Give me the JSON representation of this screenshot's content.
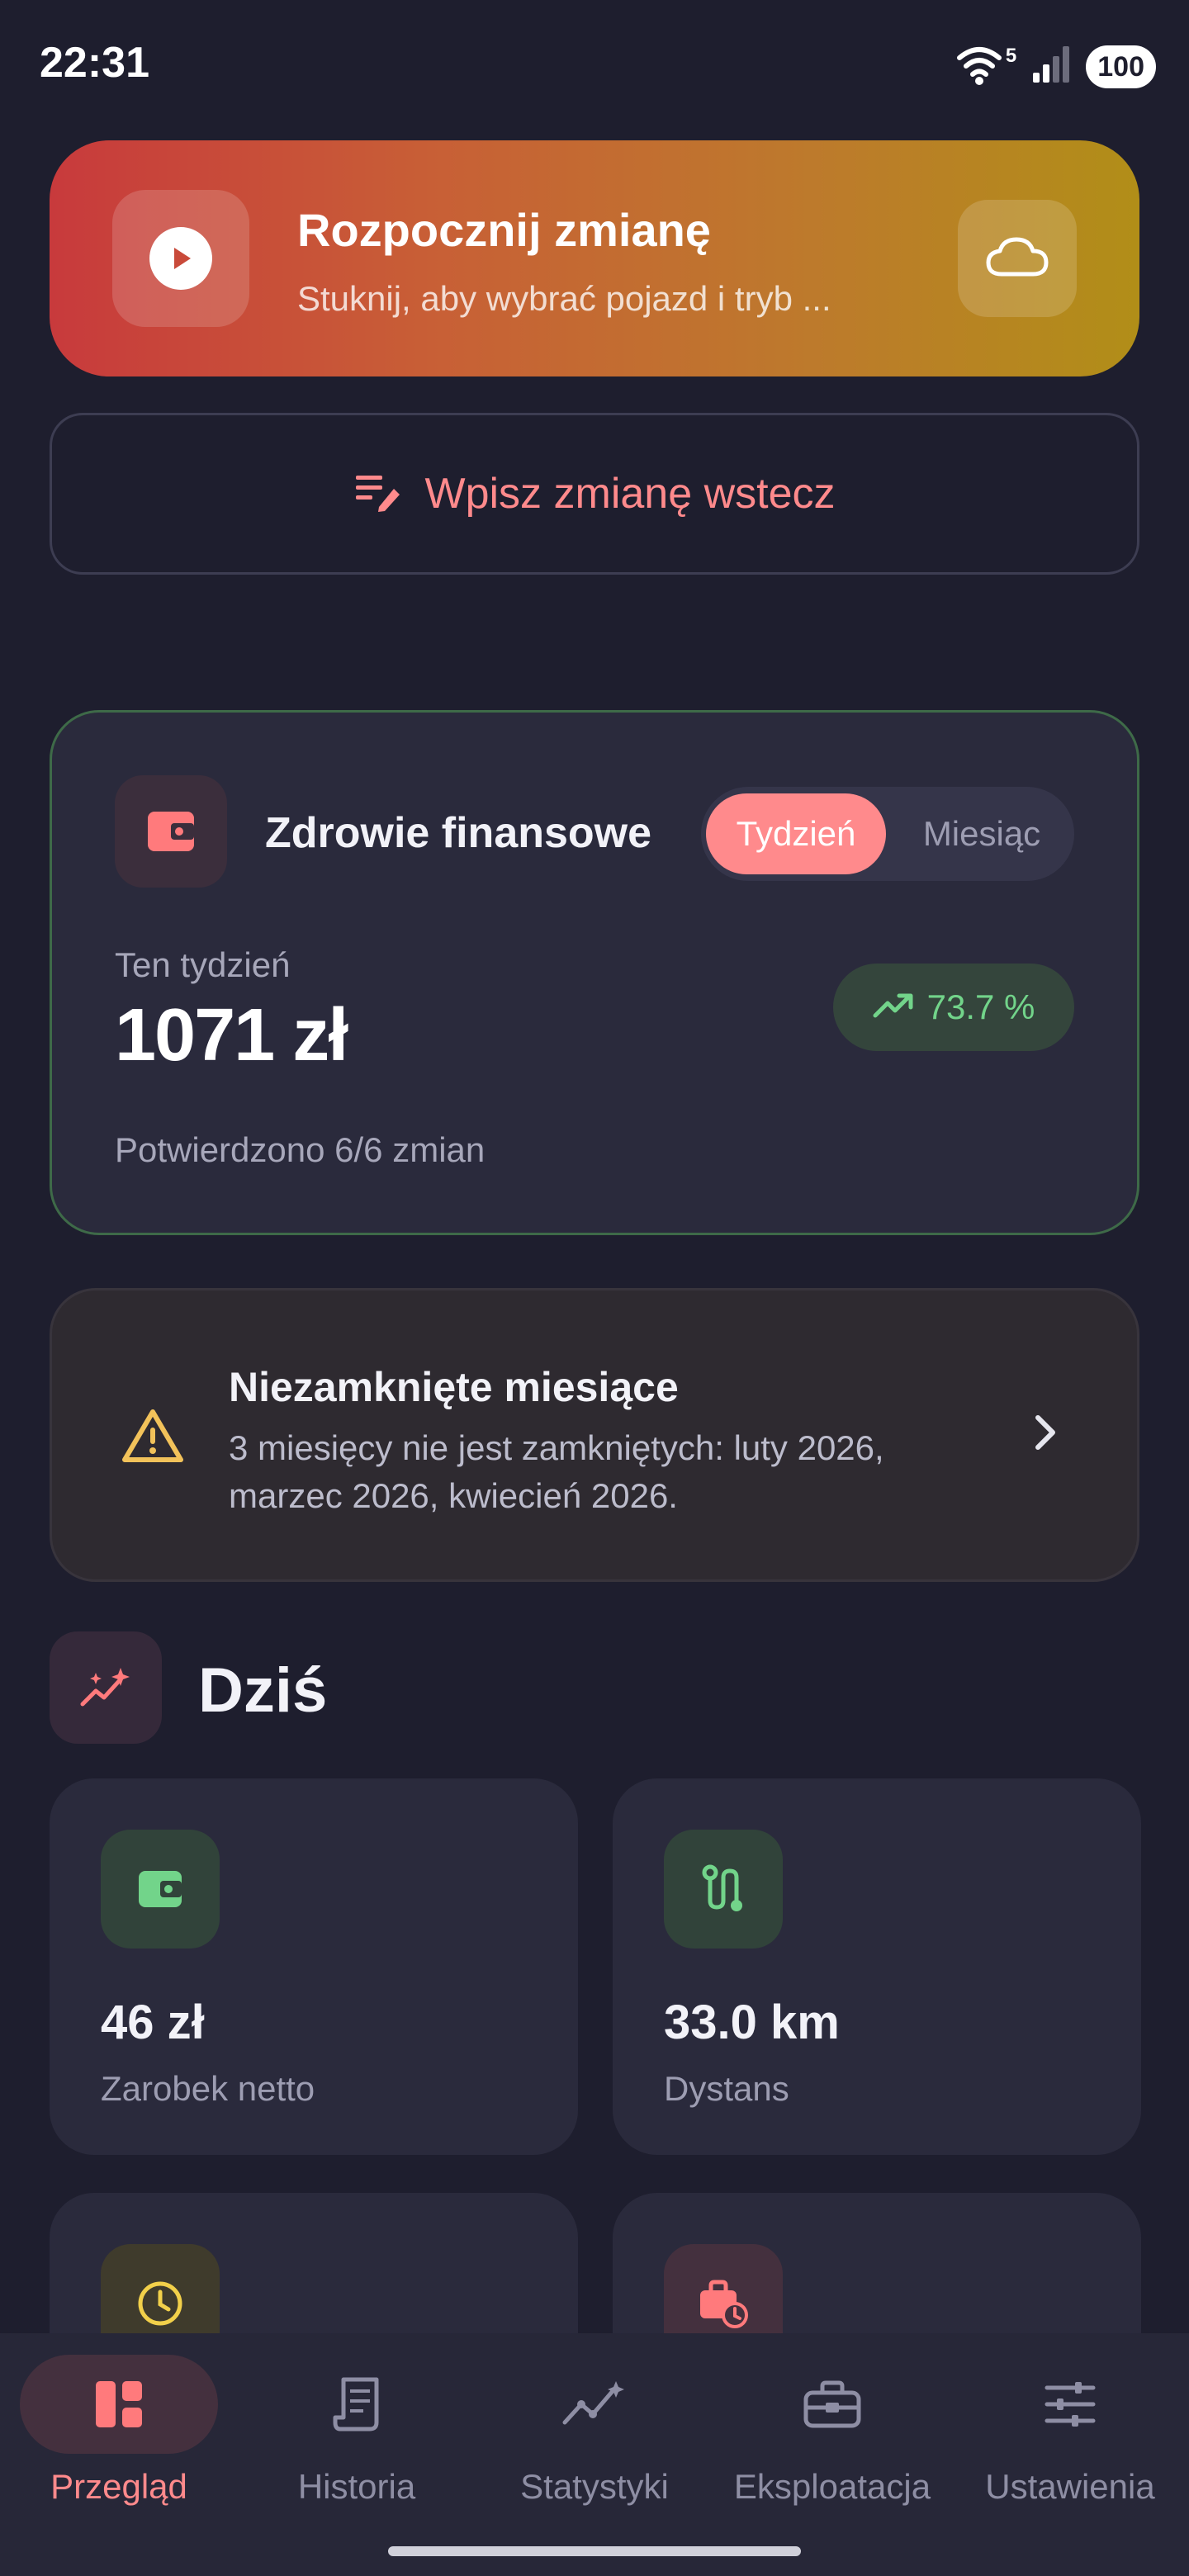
{
  "status_bar": {
    "time": "22:31",
    "wifi_badge": "5",
    "battery": "100"
  },
  "shift_banner": {
    "title": "Rozpocznij zmianę",
    "subtitle": "Stuknij, aby wybrać pojazd i tryb ...",
    "play_icon": "play-icon",
    "cloud_icon": "cloud-icon"
  },
  "retro_button": {
    "label": "Wpisz zmianę wstecz",
    "icon": "edit-note-icon"
  },
  "finance": {
    "title": "Zdrowie finansowe",
    "toggle": {
      "week": "Tydzień",
      "month": "Miesiąc",
      "selected": "Tydzień"
    },
    "period_label": "Ten tydzień",
    "amount": "1071 zł",
    "trend": "73.7 %",
    "confirmed": "Potwierdzono 6/6 zmian",
    "colors": {
      "accent": "#ff8a8c",
      "positive": "#72d48a"
    }
  },
  "warning": {
    "title": "Niezamknięte miesiące",
    "body": "3 miesięcy nie jest zamkniętych: luty 2026, marzec 2026, kwiecień 2026."
  },
  "today": {
    "title": "Dziś",
    "tiles": [
      {
        "value": "46 zł",
        "label": "Zarobek netto",
        "icon": "wallet-icon",
        "color": "#72d48a"
      },
      {
        "value": "33.0 km",
        "label": "Dystans",
        "icon": "route-icon",
        "color": "#72d48a"
      },
      {
        "value": "",
        "label": "",
        "icon": "clock-icon",
        "color": "#f2d04a"
      },
      {
        "value": "",
        "label": "",
        "icon": "work-timer-icon",
        "color": "#ff7a7c"
      }
    ]
  },
  "nav": {
    "items": [
      {
        "label": "Przegląd",
        "icon": "dashboard-icon",
        "active": true
      },
      {
        "label": "Historia",
        "icon": "receipt-icon",
        "active": false
      },
      {
        "label": "Statystyki",
        "icon": "stats-icon",
        "active": false
      },
      {
        "label": "Eksploatacja",
        "icon": "toolbox-icon",
        "active": false
      },
      {
        "label": "Ustawienia",
        "icon": "tune-icon",
        "active": false
      }
    ]
  }
}
